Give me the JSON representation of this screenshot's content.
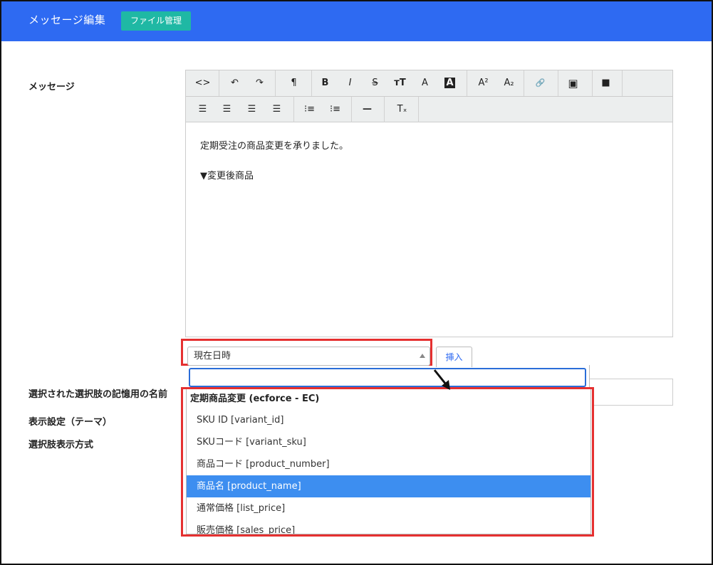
{
  "header": {
    "title": "メッセージ編集",
    "file_button": "ファイル管理"
  },
  "labels": {
    "message": "メッセージ",
    "choice_name": "選択された選択肢の記憶用の名前",
    "display_theme": "表示設定（テーマ）",
    "choice_display": "選択肢表示方式"
  },
  "toolbar": {
    "row1": [
      {
        "name": "code-view-icon",
        "glyph": "<>"
      },
      {
        "name": "undo-icon",
        "glyph": "↶"
      },
      {
        "name": "redo-icon",
        "glyph": "↷"
      },
      {
        "name": "paragraph-icon",
        "glyph": "¶"
      },
      {
        "name": "bold-icon",
        "glyph": "B"
      },
      {
        "name": "italic-icon",
        "glyph": "I"
      },
      {
        "name": "strikethrough-icon",
        "glyph": "S"
      },
      {
        "name": "font-size-icon",
        "glyph": "тT"
      },
      {
        "name": "font-color-icon",
        "glyph": "A"
      },
      {
        "name": "highlight-color-icon",
        "glyph": "A"
      },
      {
        "name": "superscript-icon",
        "glyph": "A²"
      },
      {
        "name": "subscript-icon",
        "glyph": "A₂"
      },
      {
        "name": "link-icon",
        "glyph": "🔗"
      },
      {
        "name": "image-icon",
        "glyph": "▣"
      },
      {
        "name": "video-icon",
        "glyph": "■"
      }
    ],
    "row2": [
      {
        "name": "align-left-icon",
        "glyph": "☰"
      },
      {
        "name": "align-center-icon",
        "glyph": "☰"
      },
      {
        "name": "align-right-icon",
        "glyph": "☰"
      },
      {
        "name": "justify-icon",
        "glyph": "☰"
      },
      {
        "name": "bullet-list-icon",
        "glyph": "⁝≡"
      },
      {
        "name": "numbered-list-icon",
        "glyph": "⁝≡"
      },
      {
        "name": "horizontal-rule-icon",
        "glyph": "—"
      },
      {
        "name": "clear-format-icon",
        "glyph": "Tₓ"
      }
    ]
  },
  "editor": {
    "line1": "定期受注の商品変更を承りました。",
    "line2": "▼変更後商品"
  },
  "variable_select": {
    "value": "現在日時",
    "insert_button": "挿入"
  },
  "dropdown": {
    "group": "定期商品変更 (ecforce - EC)",
    "options": [
      "SKU ID [variant_id]",
      "SKUコード [variant_sku]",
      "商品コード [product_number]",
      "商品名 [product_name]",
      "通常価格 [list_price]",
      "販売価格 [sales_price]"
    ],
    "highlighted_index": 3
  }
}
